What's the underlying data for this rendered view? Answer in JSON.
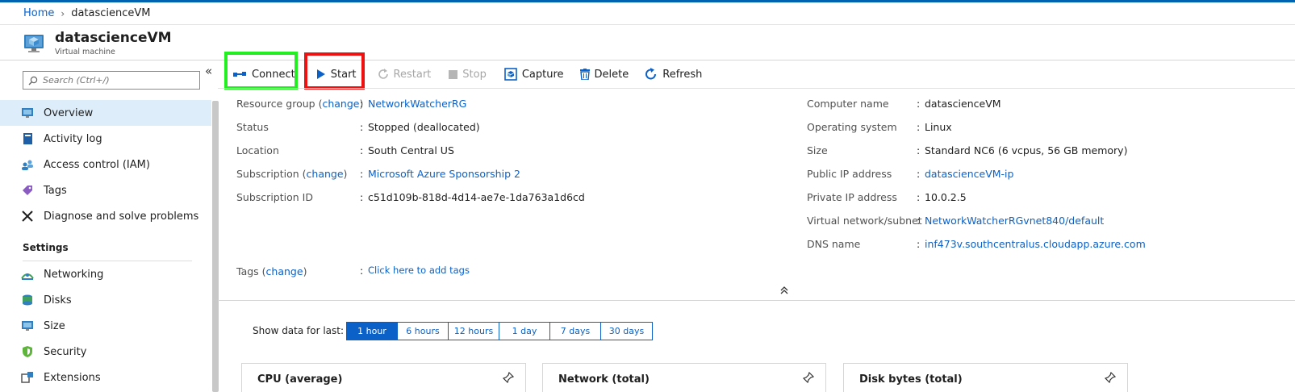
{
  "breadcrumb": {
    "home": "Home",
    "current": "datascienceVM"
  },
  "header": {
    "title": "datascienceVM",
    "subtitle": "Virtual machine"
  },
  "sidebar": {
    "search_placeholder": "Search (Ctrl+/)",
    "collapse_glyph": "«",
    "items": [
      {
        "label": "Overview",
        "icon": "monitor-icon"
      },
      {
        "label": "Activity log",
        "icon": "log-icon"
      },
      {
        "label": "Access control (IAM)",
        "icon": "people-icon"
      },
      {
        "label": "Tags",
        "icon": "tag-icon"
      },
      {
        "label": "Diagnose and solve problems",
        "icon": "wrench-icon"
      }
    ],
    "settings_header": "Settings",
    "settings_items": [
      {
        "label": "Networking",
        "icon": "network-icon"
      },
      {
        "label": "Disks",
        "icon": "disk-icon"
      },
      {
        "label": "Size",
        "icon": "monitor-icon"
      },
      {
        "label": "Security",
        "icon": "shield-icon"
      },
      {
        "label": "Extensions",
        "icon": "extensions-icon"
      }
    ]
  },
  "toolbar": {
    "connect": "Connect",
    "start": "Start",
    "restart": "Restart",
    "stop": "Stop",
    "capture": "Capture",
    "delete": "Delete",
    "refresh": "Refresh"
  },
  "essentials": {
    "change": "change",
    "left": {
      "resource_group_label": "Resource group",
      "resource_group_value": "NetworkWatcherRG",
      "status_label": "Status",
      "status_value": "Stopped (deallocated)",
      "location_label": "Location",
      "location_value": "South Central US",
      "subscription_label": "Subscription",
      "subscription_value": "Microsoft Azure Sponsorship 2",
      "subscription_id_label": "Subscription ID",
      "subscription_id_value": "c51d109b-818d-4d14-ae7e-1da763a1d6cd"
    },
    "right": {
      "computer_name_label": "Computer name",
      "computer_name_value": "datascienceVM",
      "os_label": "Operating system",
      "os_value": "Linux",
      "size_label": "Size",
      "size_value": "Standard NC6 (6 vcpus, 56 GB memory)",
      "public_ip_label": "Public IP address",
      "public_ip_value": "datascienceVM-ip",
      "private_ip_label": "Private IP address",
      "private_ip_value": "10.0.2.5",
      "vnet_label": "Virtual network/subnet",
      "vnet_value": "NetworkWatcherRGvnet840/default",
      "dns_label": "DNS name",
      "dns_value": "inf473v.southcentralus.cloudapp.azure.com"
    },
    "tags_label": "Tags",
    "tags_value": "Click here to add tags",
    "colon": ":"
  },
  "time_range": {
    "label": "Show data for last:",
    "options": [
      "1 hour",
      "6 hours",
      "12 hours",
      "1 day",
      "7 days",
      "30 days"
    ],
    "selected": "1 hour"
  },
  "cards": {
    "cpu": "CPU (average)",
    "network": "Network (total)",
    "disk": "Disk bytes (total)"
  },
  "colors": {
    "accent": "#0b61c7",
    "highlight_green": "#22ee22",
    "highlight_red": "#ee1111"
  }
}
